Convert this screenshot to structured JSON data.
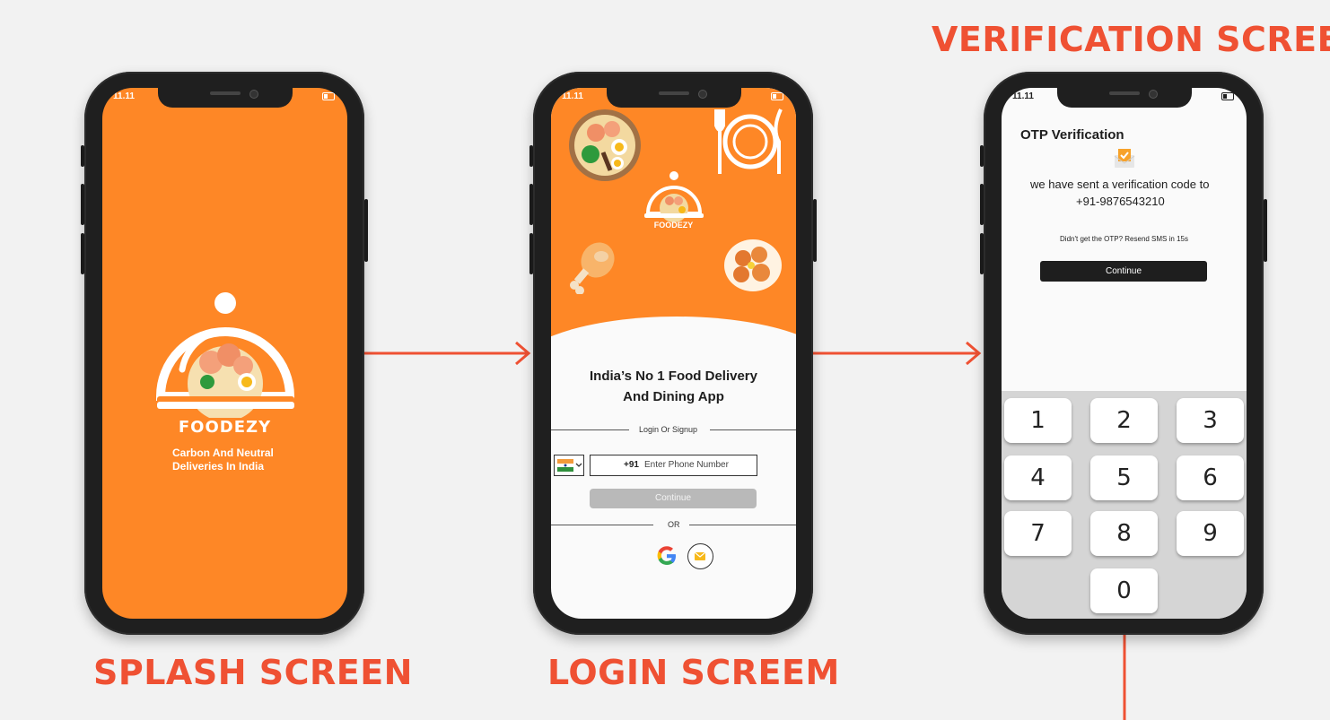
{
  "captions": {
    "splash": "SPLASH SCREEN",
    "login": "LOGIN SCREEM",
    "verification": "VERIFICATION SCREEN"
  },
  "status_time": "11.11",
  "splash": {
    "brand": "FOODEZY",
    "tagline_line1": "Carbon And Neutral",
    "tagline_line2": "Deliveries In India"
  },
  "login": {
    "brand": "FOODEZY",
    "headline_line1": "India’s No 1 Food Delivery",
    "headline_line2": "And Dining App",
    "login_label": "Login Or Signup",
    "country_code": "+91",
    "phone_placeholder": "Enter Phone Number",
    "continue_label": "Continue",
    "or_label": "OR"
  },
  "verification": {
    "title": "OTP Verification",
    "sent_line1": "we have sent a verification code to",
    "sent_line2": "+91-9876543210",
    "resend_text": "Didn't get the OTP? Resend SMS in 15s",
    "continue_label": "Continue",
    "keys": [
      "1",
      "2",
      "3",
      "4",
      "5",
      "6",
      "7",
      "8",
      "9",
      "0"
    ]
  },
  "colors": {
    "brand_orange": "#fe8726",
    "caption_red": "#ef5133",
    "dark": "#1e1e1e"
  }
}
